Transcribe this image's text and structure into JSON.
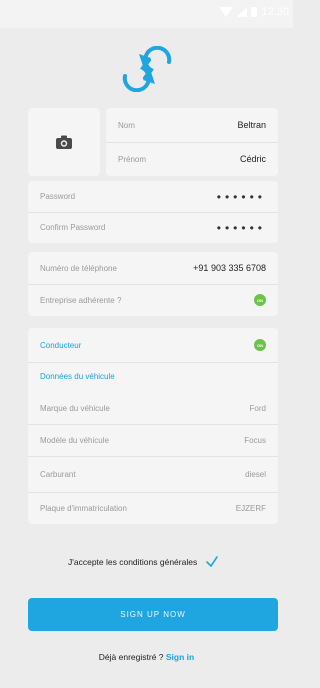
{
  "status_bar": {
    "time": "12:30"
  },
  "profile": {
    "nom_label": "Nom",
    "nom_value": "Beltran",
    "prenom_label": "Prénom",
    "prenom_value": "Cédric"
  },
  "passwords": {
    "password_label": "Password",
    "password_value": "••••••",
    "confirm_label": "Confirm Password",
    "confirm_value": "••••••"
  },
  "contact": {
    "phone_label": "Numéro de téléphone",
    "phone_value": "+91 903 335 6708",
    "entreprise_label": "Entreprise adhérente ?",
    "entreprise_toggle": "ON"
  },
  "driver": {
    "conducteur_label": "Conducteur",
    "conducteur_toggle": "ON",
    "vehicle_section": "Données du véhicule",
    "marque_label": "Marque du véhicule",
    "marque_value": "Ford",
    "modele_label": "Modèle du véhicule",
    "modele_value": "Focus",
    "carburant_label": "Carburant",
    "carburant_value": "diesel",
    "plaque_label": "Plaque d'immatriculation",
    "plaque_value": "EJZERF"
  },
  "terms_label": "J'accepte les conditions générales",
  "signup_label": "SIGN UP NOW",
  "already": {
    "question": "Déjà enregistré ? ",
    "link": "Sign in"
  },
  "colors": {
    "accent": "#1fa6e0",
    "toggle": "#6cc24a"
  }
}
